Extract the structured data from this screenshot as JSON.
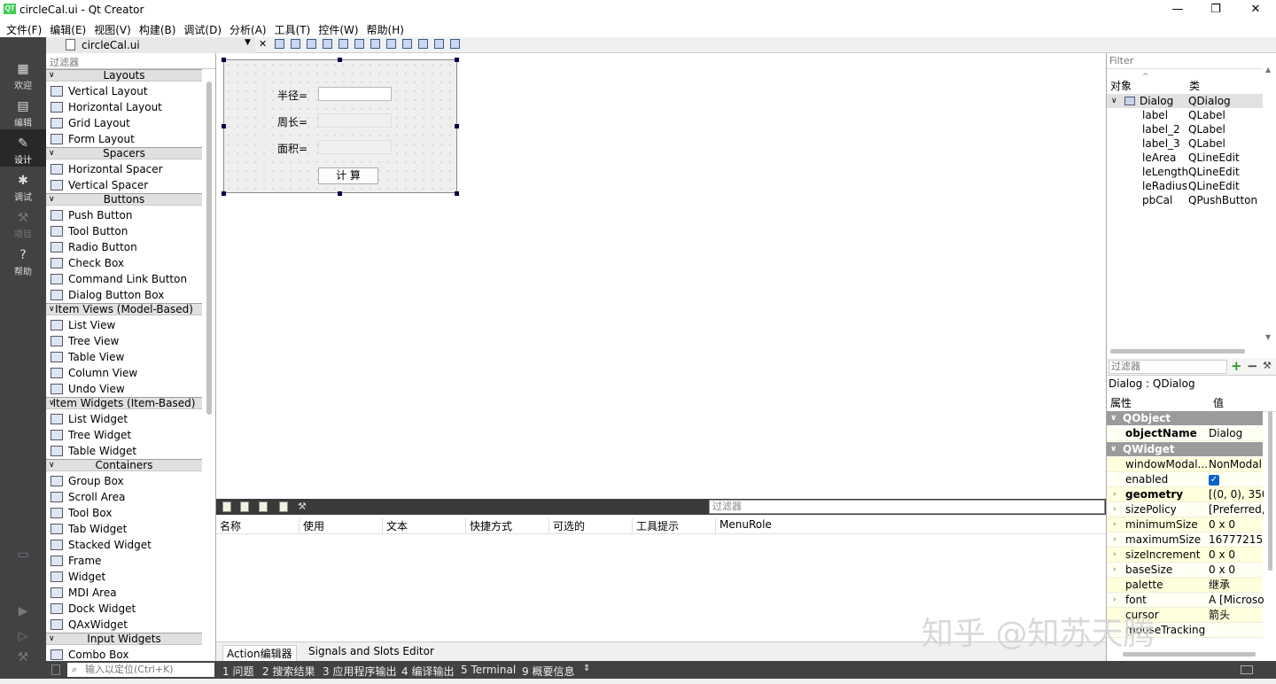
{
  "window": {
    "title": "circleCal.ui - Qt Creator",
    "logo": "QT"
  },
  "menu": [
    "文件(F)",
    "编辑(E)",
    "视图(V)",
    "构建(B)",
    "调试(D)",
    "分析(A)",
    "工具(T)",
    "控件(W)",
    "帮助(H)"
  ],
  "modes": [
    {
      "label": "欢迎",
      "icon": "grid-icon"
    },
    {
      "label": "编辑",
      "icon": "document-icon"
    },
    {
      "label": "设计",
      "icon": "pencil-icon"
    },
    {
      "label": "调试",
      "icon": "bug-icon"
    },
    {
      "label": "项目",
      "icon": "wrench-icon"
    },
    {
      "label": "帮助",
      "icon": "help-icon"
    }
  ],
  "file_tab": {
    "name": "circleCal.ui"
  },
  "widget_box": {
    "filter_placeholder": "过滤器",
    "sections": [
      {
        "title": "Layouts",
        "items": [
          "Vertical Layout",
          "Horizontal Layout",
          "Grid Layout",
          "Form Layout"
        ]
      },
      {
        "title": "Spacers",
        "items": [
          "Horizontal Spacer",
          "Vertical Spacer"
        ]
      },
      {
        "title": "Buttons",
        "items": [
          "Push Button",
          "Tool Button",
          "Radio Button",
          "Check Box",
          "Command Link Button",
          "Dialog Button Box"
        ]
      },
      {
        "title": "Item Views (Model-Based)",
        "items": [
          "List View",
          "Tree View",
          "Table View",
          "Column View",
          "Undo View"
        ]
      },
      {
        "title": "Item Widgets (Item-Based)",
        "items": [
          "List Widget",
          "Tree Widget",
          "Table Widget"
        ]
      },
      {
        "title": "Containers",
        "items": [
          "Group Box",
          "Scroll Area",
          "Tool Box",
          "Tab Widget",
          "Stacked Widget",
          "Frame",
          "Widget",
          "MDI Area",
          "Dock Widget",
          "QAxWidget"
        ]
      },
      {
        "title": "Input Widgets",
        "items": [
          "Combo Box"
        ]
      }
    ]
  },
  "form": {
    "radius_label": "半径=",
    "perimeter_label": "周长=",
    "area_label": "面积=",
    "calc_button": "计 算"
  },
  "action_editor": {
    "filter_placeholder": "过滤器",
    "columns": [
      "名称",
      "使用",
      "文本",
      "快捷方式",
      "可选的",
      "工具提示",
      "MenuRole"
    ],
    "tabs": [
      "Action编辑器",
      "Signals and Slots Editor"
    ]
  },
  "object_inspector": {
    "filter_placeholder": "Filter",
    "col_object": "对象",
    "col_class": "类",
    "rows": [
      {
        "name": "Dialog",
        "cls": "QDialog"
      },
      {
        "name": "label",
        "cls": "QLabel"
      },
      {
        "name": "label_2",
        "cls": "QLabel"
      },
      {
        "name": "label_3",
        "cls": "QLabel"
      },
      {
        "name": "leArea",
        "cls": "QLineEdit"
      },
      {
        "name": "leLength",
        "cls": "QLineEdit"
      },
      {
        "name": "leRadius",
        "cls": "QLineEdit"
      },
      {
        "name": "pbCal",
        "cls": "QPushButton"
      }
    ]
  },
  "property_editor": {
    "filter_placeholder": "过滤器",
    "title": "Dialog : QDialog",
    "col_prop": "属性",
    "col_value": "值",
    "group_qobject": "QObject",
    "group_qwidget": "QWidget",
    "rows": [
      {
        "name": "objectName",
        "value": "Dialog"
      },
      {
        "name": "windowModal...",
        "value": "NonModal"
      },
      {
        "name": "enabled",
        "value": ""
      },
      {
        "name": "geometry",
        "value": "[(0, 0), 350"
      },
      {
        "name": "sizePolicy",
        "value": "[Preferred,"
      },
      {
        "name": "minimumSize",
        "value": "0 x 0"
      },
      {
        "name": "maximumSize",
        "value": "16777215 x"
      },
      {
        "name": "sizeIncrement",
        "value": "0 x 0"
      },
      {
        "name": "baseSize",
        "value": "0 x 0"
      },
      {
        "name": "palette",
        "value": "继承"
      },
      {
        "name": "font",
        "value": "A [Microso"
      },
      {
        "name": "cursor",
        "value": "箭头"
      },
      {
        "name": "mouseTracking",
        "value": ""
      }
    ]
  },
  "statusbar": {
    "locator_placeholder": "输入以定位(Ctrl+K)",
    "tabs": [
      "1 问题",
      "2 搜索结果",
      "3 应用程序输出",
      "4 编译输出",
      "5 Terminal",
      "9 概要信息"
    ]
  },
  "watermark": "知乎 @知苏天腾"
}
